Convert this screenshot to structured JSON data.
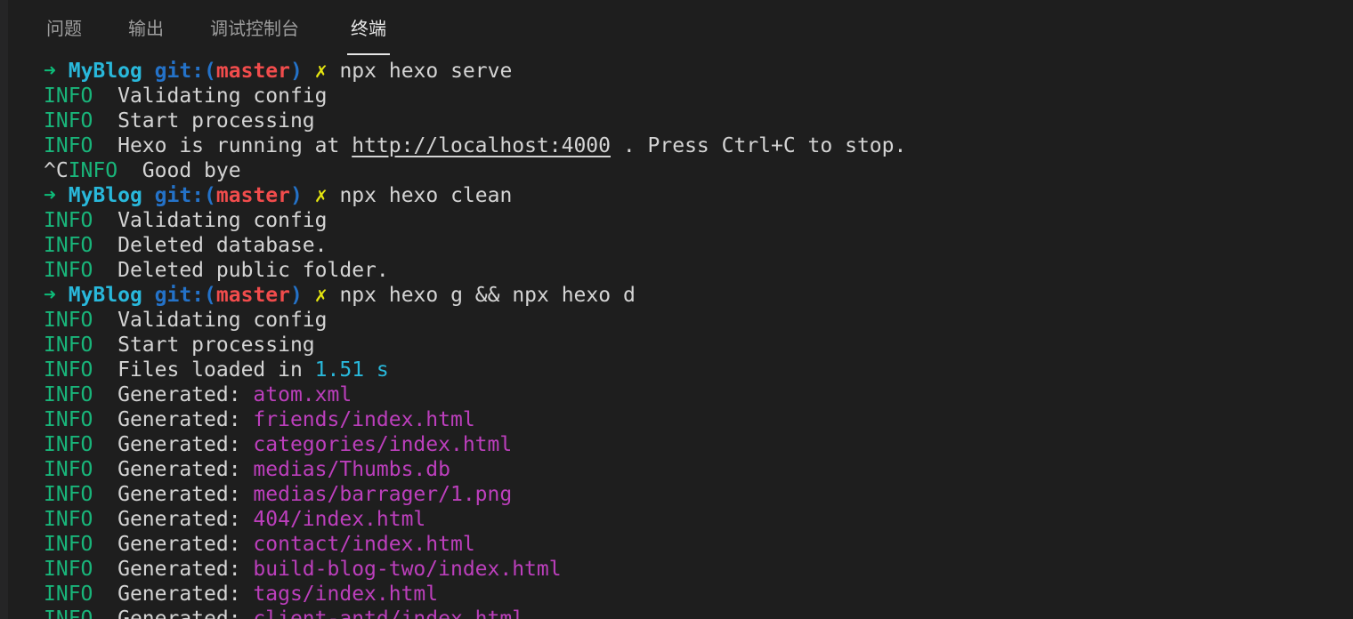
{
  "tabs": [
    {
      "label": "问题",
      "active": false
    },
    {
      "label": "输出",
      "active": false
    },
    {
      "label": "调试控制台",
      "active": false
    },
    {
      "label": "终端",
      "active": true
    }
  ],
  "prompt": {
    "arrow": "➜",
    "dir": "MyBlog",
    "git_prefix": "git:(",
    "branch": "master",
    "git_suffix": ")",
    "dirty": "✗"
  },
  "lines": [
    {
      "type": "prompt",
      "cmd": "npx hexo serve"
    },
    {
      "type": "info",
      "prefix": "",
      "level": "INFO",
      "msg": "Validating config"
    },
    {
      "type": "info",
      "prefix": "",
      "level": "INFO",
      "msg": "Start processing"
    },
    {
      "type": "info-link",
      "level": "INFO",
      "msg": "Hexo is running at ",
      "link": "http://localhost:4000",
      "after": " . Press Ctrl+C to stop."
    },
    {
      "type": "info",
      "prefix": "^C",
      "level": "INFO",
      "msg": "Good bye"
    },
    {
      "type": "prompt",
      "cmd": "npx hexo clean"
    },
    {
      "type": "info",
      "prefix": "",
      "level": "INFO",
      "msg": "Validating config"
    },
    {
      "type": "info",
      "prefix": "",
      "level": "INFO",
      "msg": "Deleted database."
    },
    {
      "type": "info",
      "prefix": "",
      "level": "INFO",
      "msg": "Deleted public folder."
    },
    {
      "type": "prompt",
      "cmd": "npx hexo g && npx hexo d"
    },
    {
      "type": "info",
      "prefix": "",
      "level": "INFO",
      "msg": "Validating config"
    },
    {
      "type": "info",
      "prefix": "",
      "level": "INFO",
      "msg": "Start processing"
    },
    {
      "type": "info-num",
      "level": "INFO",
      "msg": "Files loaded in ",
      "num": "1.51 s"
    },
    {
      "type": "info-path",
      "level": "INFO",
      "msg": "Generated: ",
      "path": "atom.xml"
    },
    {
      "type": "info-path",
      "level": "INFO",
      "msg": "Generated: ",
      "path": "friends/index.html"
    },
    {
      "type": "info-path",
      "level": "INFO",
      "msg": "Generated: ",
      "path": "categories/index.html"
    },
    {
      "type": "info-path",
      "level": "INFO",
      "msg": "Generated: ",
      "path": "medias/Thumbs.db"
    },
    {
      "type": "info-path",
      "level": "INFO",
      "msg": "Generated: ",
      "path": "medias/barrager/1.png"
    },
    {
      "type": "info-path",
      "level": "INFO",
      "msg": "Generated: ",
      "path": "404/index.html"
    },
    {
      "type": "info-path",
      "level": "INFO",
      "msg": "Generated: ",
      "path": "contact/index.html"
    },
    {
      "type": "info-path",
      "level": "INFO",
      "msg": "Generated: ",
      "path": "build-blog-two/index.html"
    },
    {
      "type": "info-path",
      "level": "INFO",
      "msg": "Generated: ",
      "path": "tags/index.html"
    },
    {
      "type": "info-path",
      "level": "INFO",
      "msg": "Generated: ",
      "path": "client-antd/index.html"
    }
  ],
  "colors": {
    "background": "#1e1e1e",
    "info": "#19b57a",
    "path": "#bc3fbc",
    "branch": "#f14c4c",
    "dir": "#29b8db"
  }
}
